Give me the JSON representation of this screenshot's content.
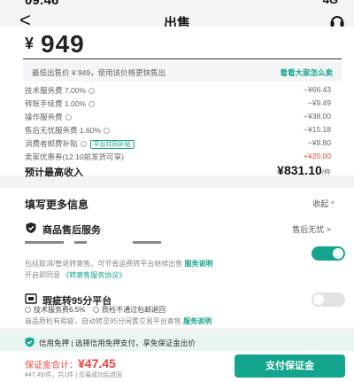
{
  "status": {
    "time": "09:46",
    "network": "4G"
  },
  "nav": {
    "back": "<",
    "title": "出售"
  },
  "price": {
    "currency": "¥",
    "value": "949"
  },
  "lowest": {
    "text": "最低出售价 ¥ 949，使用该价格更快售出",
    "link": "看看大家怎么卖"
  },
  "fees": [
    {
      "label": "技术服务费 7.00%",
      "value": "−¥66.43"
    },
    {
      "label": "转账手续费 1.00%",
      "value": "−¥9.49"
    },
    {
      "label": "操作服务费",
      "value": "−¥38.00"
    },
    {
      "label": "售后无忧服务费 1.60%",
      "value": "−¥15.18"
    },
    {
      "label": "消费者邮费补贴",
      "badge": "平台共同补贴",
      "value": "−¥8.80"
    },
    {
      "label": "卖家优惠券(12.10前发货可享)",
      "value": "+¥20.00"
    }
  ],
  "income": {
    "label": "预计最高收入",
    "value": "¥831.10",
    "unit": "/件"
  },
  "more": {
    "title": "填写更多信息",
    "collapse": "收起 ^"
  },
  "after_sale": {
    "label": "商品售后服务",
    "value": "售后无忧 >",
    "enabled": true
  },
  "after_sale_desc": {
    "text": "包括取消/管退转寄售、可节省运费转平台继续出售",
    "link": "服务说明",
    "line2": "开启即同意",
    "doc": "《转寄售服务协议》"
  },
  "flaw": {
    "label": "瑕疵转95分平台",
    "enabled": false
  },
  "flaw_checks": {
    "a": "技术服务费6.5%",
    "b": "质检不通过包邮退回"
  },
  "flaw_desc": {
    "text": "商品质检有瑕疵，自动转至95分闲置交易平台寄售",
    "link": "服务说明"
  },
  "credit": {
    "text": "信用免押 | 选择信用免押支付，享免保证金出价"
  },
  "deposit": {
    "label": "保证金合计：",
    "value": "¥47.45",
    "sub": "¥47.45/件，共1件 | 交易成功后退回"
  },
  "pay_button": "支付保证金",
  "colors": {
    "accent": "#15a48d",
    "red": "#e8473c"
  }
}
